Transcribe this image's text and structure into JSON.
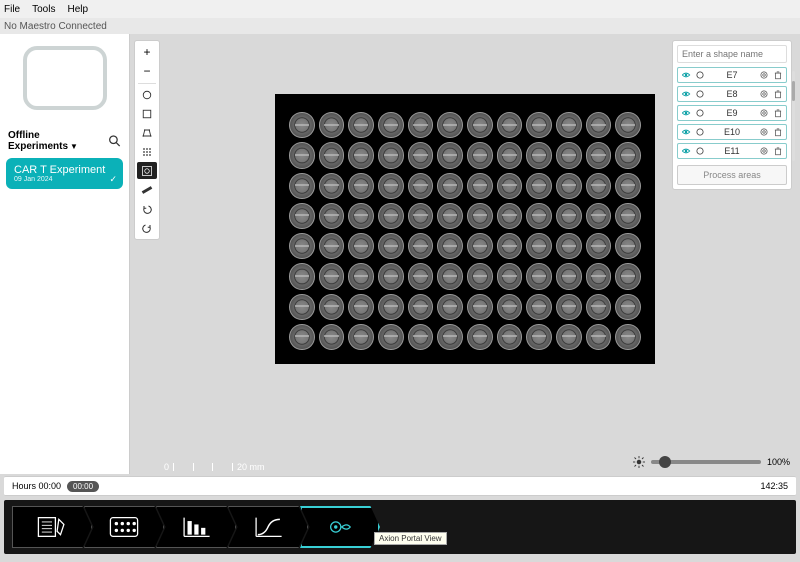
{
  "menu": {
    "file": "File",
    "tools": "Tools",
    "help": "Help"
  },
  "status": {
    "connection": "No Maestro Connected"
  },
  "sidebar": {
    "offline_label": "Offline Experiments",
    "experiment": {
      "name": "CAR T Experiment",
      "date": "09 Jan 2024"
    }
  },
  "tools": {
    "zoom_in": "+",
    "zoom_out": "−",
    "circle": "circle",
    "rect": "rect",
    "polygon": "polygon",
    "grid": "grid",
    "focus": "focus",
    "ruler": "ruler",
    "undo": "undo",
    "redo": "redo"
  },
  "canvas": {
    "scale_zero": "0",
    "scale_label": "20 mm",
    "plate": {
      "rows": 8,
      "cols": 12
    }
  },
  "shapes": {
    "placeholder": "Enter a shape name",
    "items": [
      {
        "label": "E7"
      },
      {
        "label": "E8"
      },
      {
        "label": "E9"
      },
      {
        "label": "E10"
      },
      {
        "label": "E11"
      }
    ],
    "process_label": "Process areas"
  },
  "brightness": {
    "percent": "100%"
  },
  "timeline": {
    "hours_label": "Hours 00:00",
    "current": "00:00",
    "end": "142:35"
  },
  "bottomnav": {
    "steps": [
      "notes",
      "plate",
      "bars",
      "curve",
      "portal"
    ],
    "active_index": 4,
    "tooltip": "Axion Portal View"
  }
}
